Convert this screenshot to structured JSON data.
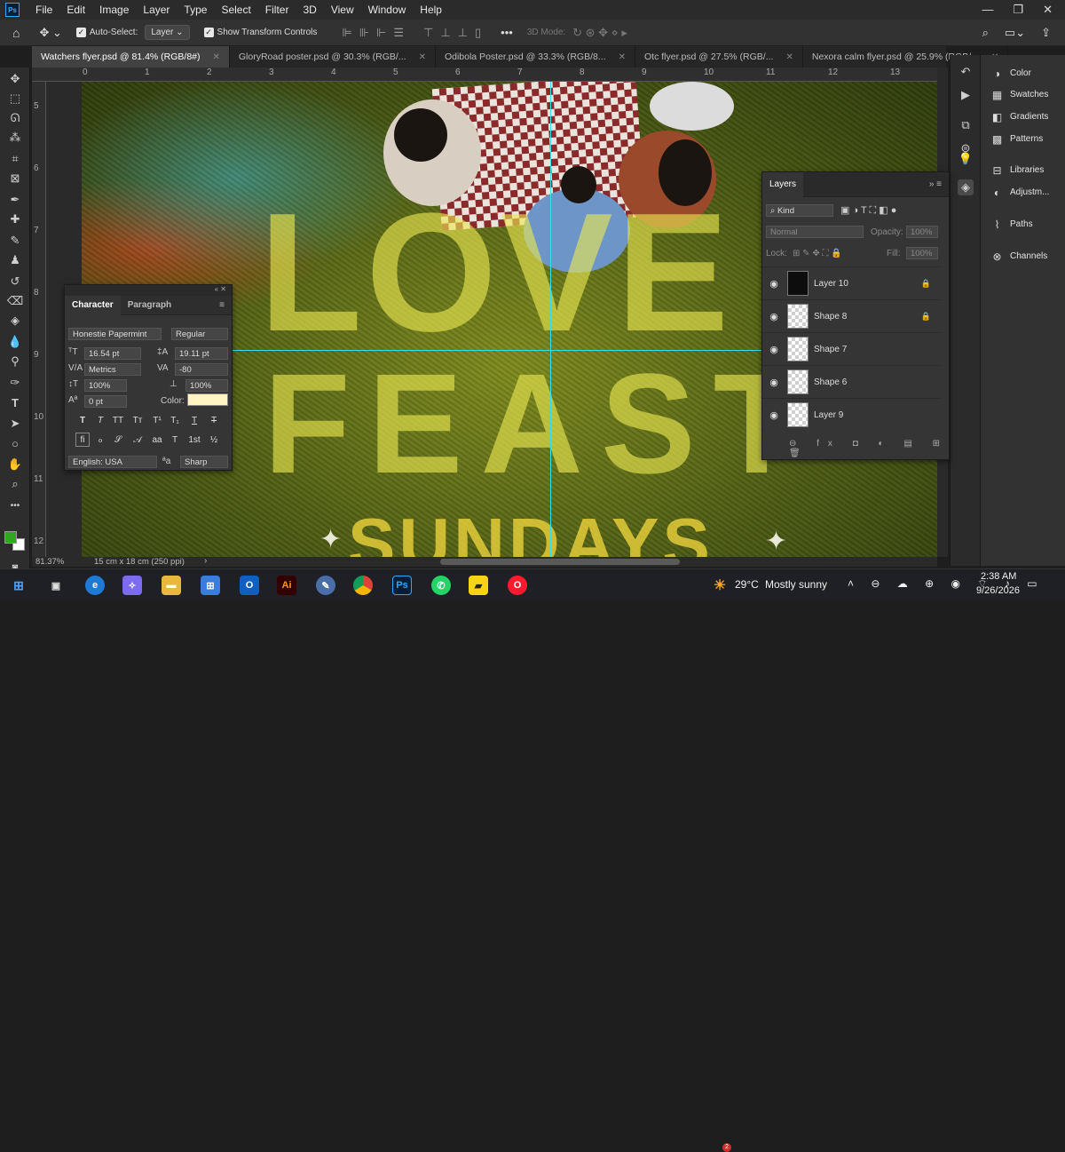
{
  "app": {
    "logo": "Ps",
    "menu": [
      "File",
      "Edit",
      "Image",
      "Layer",
      "Type",
      "Select",
      "Filter",
      "3D",
      "View",
      "Window",
      "Help"
    ]
  },
  "options": {
    "auto_select_label": "Auto-Select:",
    "auto_select_value": "Layer",
    "show_transform_label": "Show Transform Controls",
    "mode_3d_label": "3D Mode:",
    "more": "•••"
  },
  "tabs": [
    {
      "label": "Watchers flyer.psd @ 81.4% (RGB/8#)",
      "active": true
    },
    {
      "label": "GloryRoad poster.psd @ 30.3% (RGB/...",
      "active": false
    },
    {
      "label": "Odibola Poster.psd @ 33.3% (RGB/8...",
      "active": false
    },
    {
      "label": "Otc flyer.psd @ 27.5% (RGB/...",
      "active": false
    },
    {
      "label": "Nexora calm flyer.psd @ 25.9% (RGB/...",
      "active": false
    }
  ],
  "ruler": {
    "h": [
      "0",
      "1",
      "2",
      "3",
      "4",
      "5",
      "6",
      "7",
      "8",
      "9",
      "10",
      "11",
      "12",
      "13"
    ],
    "v": [
      "5",
      "6",
      "7",
      "8",
      "9",
      "10",
      "11",
      "12"
    ]
  },
  "artwork": {
    "line1": "LOVE",
    "line2": "FEAST",
    "line3": "SUNDAYS"
  },
  "character": {
    "tab_character": "Character",
    "tab_paragraph": "Paragraph",
    "font_family": "Honestie Papermint",
    "font_style": "Regular",
    "font_size": "16.54 pt",
    "leading": "19.11 pt",
    "kerning": "Metrics",
    "tracking": "-80",
    "vscale": "100%",
    "hscale": "100%",
    "baseline": "0 pt",
    "color_label": "Color:",
    "color": "#fff6c4",
    "language": "English: USA",
    "aa_label": "a",
    "antialias": "Sharp"
  },
  "layers": {
    "tab": "Layers",
    "filter_kind": "Kind",
    "blend": "Normal",
    "opacity_label": "Opacity:",
    "opacity": "100%",
    "lock_label": "Lock:",
    "fill_label": "Fill:",
    "fill": "100%",
    "items": [
      {
        "name": "Layer 10",
        "locked": true,
        "dark": true
      },
      {
        "name": "Shape 8",
        "locked": true,
        "dark": false
      },
      {
        "name": "Shape 7",
        "locked": false,
        "dark": false
      },
      {
        "name": "Shape 6",
        "locked": false,
        "dark": false
      },
      {
        "name": "Layer 9",
        "locked": false,
        "dark": false
      }
    ]
  },
  "panels": [
    "Color",
    "Swatches",
    "Gradients",
    "Patterns",
    "Libraries",
    "Adjustm...",
    "Paths",
    "Channels"
  ],
  "status": {
    "zoom": "81.37%",
    "doc": "15 cm x 18 cm (250 ppi)"
  },
  "taskbar": {
    "weather_badge": "2",
    "weather": "29°C",
    "weather_desc": "Mostly sunny",
    "time": "2:38 AM",
    "date": "9/26/2026"
  },
  "colors": {
    "foreground": "#2fa81f",
    "background": "#ffffff",
    "guide": "#34e0ef"
  }
}
